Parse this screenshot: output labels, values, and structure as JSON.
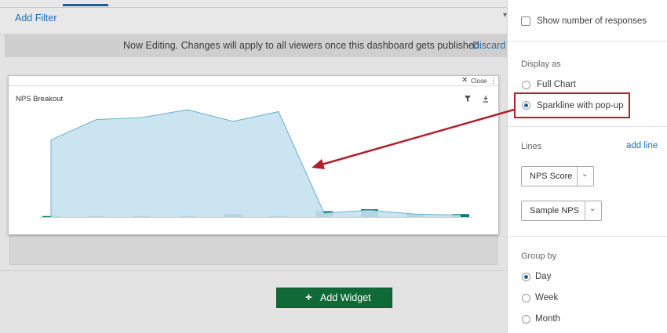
{
  "toolbar": {
    "add_filter": "Add Filter"
  },
  "banner": {
    "message": "Now Editing. Changes will apply to all viewers once this dashboard gets published.",
    "discard": "Discard"
  },
  "popup": {
    "close_label": "Close",
    "title": "NPS Breakout"
  },
  "add_widget": {
    "label": "Add Widget"
  },
  "panel": {
    "show_responses": "Show number of responses",
    "display_as": {
      "title": "Display as",
      "options": [
        {
          "label": "Full Chart",
          "selected": false
        },
        {
          "label": "Sparkline with pop-up",
          "selected": true
        }
      ]
    },
    "lines": {
      "title": "Lines",
      "add_line": "add line",
      "items": [
        "NPS Score",
        "Sample NPS"
      ]
    },
    "group_by": {
      "title": "Group by",
      "options": [
        {
          "label": "Day",
          "selected": true
        },
        {
          "label": "Week",
          "selected": false
        },
        {
          "label": "Month",
          "selected": false
        }
      ]
    }
  },
  "colors": {
    "area_fill": "#c4e1ee",
    "area_stroke": "#6aaed2",
    "bar": "#0d7a64",
    "annotation": "#b0202d",
    "button_green": "#0f6a38"
  },
  "chart_data": {
    "type": "area",
    "title": "NPS Breakout",
    "series": [
      {
        "values": [
          79,
          100,
          102,
          110,
          98,
          108,
          4,
          7,
          3,
          2
        ]
      },
      {
        "values": [
          1,
          1,
          1,
          1,
          3,
          1,
          6,
          8,
          3,
          3
        ]
      }
    ]
  }
}
